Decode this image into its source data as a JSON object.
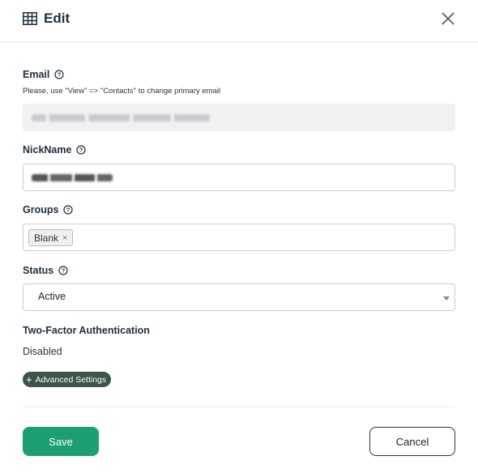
{
  "dialog": {
    "title": "Edit",
    "icons": {
      "title_icon": "table-icon",
      "close_icon": "close-icon",
      "help_icon": "help-circle-icon"
    }
  },
  "email": {
    "label": "Email",
    "hint": "Please, use \"View\" => \"Contacts\" to change primary email",
    "value": ""
  },
  "nickname": {
    "label": "NickName",
    "value": ""
  },
  "groups": {
    "label": "Groups",
    "tags": [
      "Blank"
    ],
    "remove_glyph": "×"
  },
  "status": {
    "label": "Status",
    "value": "Active"
  },
  "two_factor": {
    "label": "Two-Factor Authentication",
    "value": "Disabled"
  },
  "advanced": {
    "plus": "+",
    "label": "Advanced Settings"
  },
  "footer": {
    "save_label": "Save",
    "cancel_label": "Cancel"
  },
  "colors": {
    "primary": "#1e9e73",
    "advanced_bg": "#3d5446",
    "text": "#1f2d3d",
    "border": "#c9ced4"
  }
}
